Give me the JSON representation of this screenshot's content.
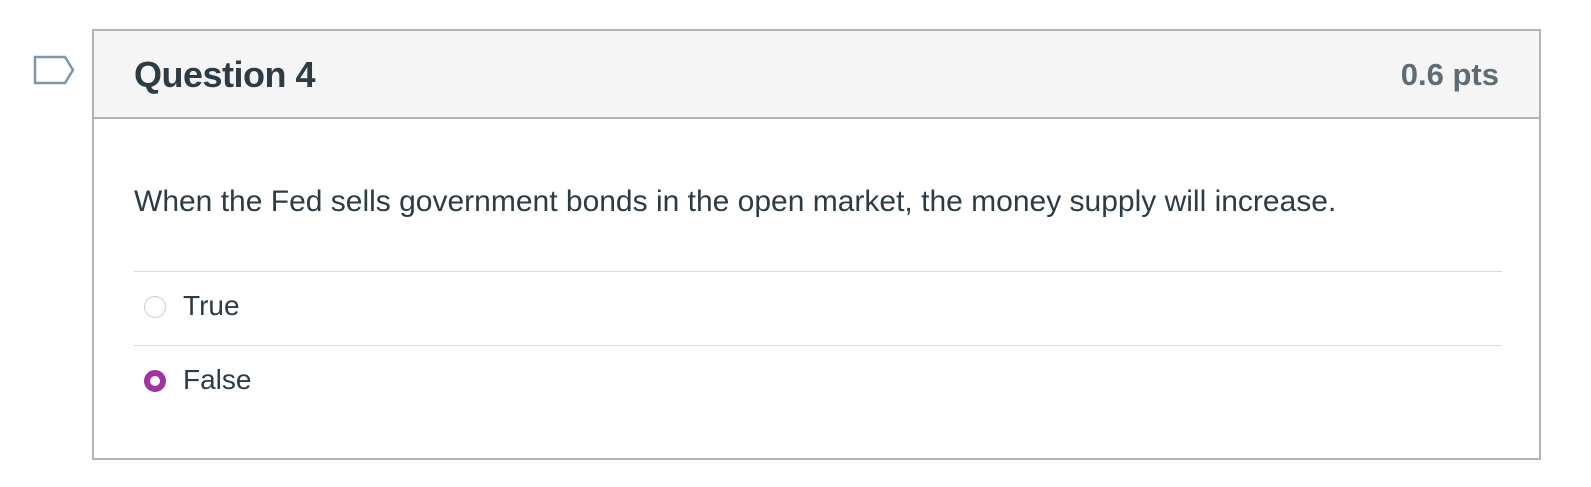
{
  "flag": {
    "icon": "flag-outline-icon",
    "color": "#7a98b0"
  },
  "question": {
    "title": "Question 4",
    "points": "0.6 pts",
    "text": "When the Fed sells government bonds in the open market, the money supply will increase."
  },
  "answers": [
    {
      "label": "True",
      "selected": false
    },
    {
      "label": "False",
      "selected": true
    }
  ],
  "colors": {
    "header_bg": "#f5f5f5",
    "border": "#b3b3b3",
    "selected_radio": "#a0339f",
    "text": "#2d3b45",
    "points_text": "#5f6b73"
  }
}
